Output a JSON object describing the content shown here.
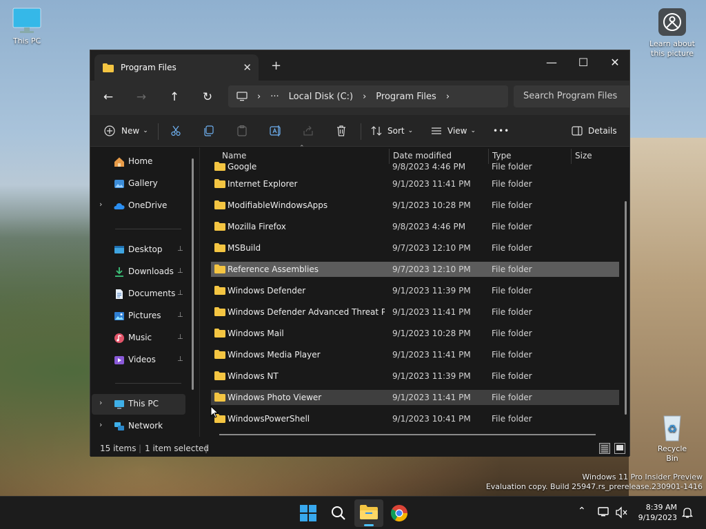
{
  "desktop": {
    "this_pc": "This PC",
    "learn": "Learn about this picture",
    "recycle": "Recycle Bin",
    "watermark1": "Windows 11 Pro Insider Preview",
    "watermark2": "Evaluation copy. Build 25947.rs_prerelease.230901-1416"
  },
  "window": {
    "tab_title": "Program Files",
    "close_tab": "✕",
    "new_tab": "+",
    "min": "—",
    "max": "☐",
    "close": "✕"
  },
  "address": {
    "back": "←",
    "forward": "→",
    "up": "↑",
    "refresh": "↻",
    "more": "···",
    "crumb1": "Local Disk (C:)",
    "crumb2": "Program Files",
    "sep": "›",
    "search_placeholder": "Search Program Files"
  },
  "commands": {
    "new": "New",
    "sort": "Sort",
    "view": "View",
    "more": "•••",
    "details": "Details"
  },
  "nav": {
    "home": "Home",
    "gallery": "Gallery",
    "onedrive": "OneDrive",
    "desktop": "Desktop",
    "downloads": "Downloads",
    "documents": "Documents",
    "pictures": "Pictures",
    "music": "Music",
    "videos": "Videos",
    "thispc": "This PC",
    "network": "Network",
    "chevron": "›",
    "pin": "📌"
  },
  "columns": {
    "name": "Name",
    "date": "Date modified",
    "type": "Type",
    "size": "Size"
  },
  "files": [
    {
      "name": "Google",
      "date": "9/8/2023 4:46 PM",
      "type": "File folder"
    },
    {
      "name": "Internet Explorer",
      "date": "9/1/2023 11:41 PM",
      "type": "File folder"
    },
    {
      "name": "ModifiableWindowsApps",
      "date": "9/1/2023 10:28 PM",
      "type": "File folder"
    },
    {
      "name": "Mozilla Firefox",
      "date": "9/8/2023 4:46 PM",
      "type": "File folder"
    },
    {
      "name": "MSBuild",
      "date": "9/7/2023 12:10 PM",
      "type": "File folder"
    },
    {
      "name": "Reference Assemblies",
      "date": "9/7/2023 12:10 PM",
      "type": "File folder"
    },
    {
      "name": "Windows Defender",
      "date": "9/1/2023 11:39 PM",
      "type": "File folder"
    },
    {
      "name": "Windows Defender Advanced Threat Pro...",
      "date": "9/1/2023 11:41 PM",
      "type": "File folder"
    },
    {
      "name": "Windows Mail",
      "date": "9/1/2023 10:28 PM",
      "type": "File folder"
    },
    {
      "name": "Windows Media Player",
      "date": "9/1/2023 11:41 PM",
      "type": "File folder"
    },
    {
      "name": "Windows NT",
      "date": "9/1/2023 11:39 PM",
      "type": "File folder"
    },
    {
      "name": "Windows Photo Viewer",
      "date": "9/1/2023 11:41 PM",
      "type": "File folder"
    },
    {
      "name": "WindowsPowerShell",
      "date": "9/1/2023 10:41 PM",
      "type": "File folder"
    }
  ],
  "status": {
    "count": "15 items",
    "selected": "1 item selected"
  },
  "taskbar": {
    "time": "8:39 AM",
    "date": "9/19/2023"
  },
  "colors": {
    "folder": "#f4c542",
    "accent": "#0078d4",
    "selected_row": "#5c5c5c"
  }
}
